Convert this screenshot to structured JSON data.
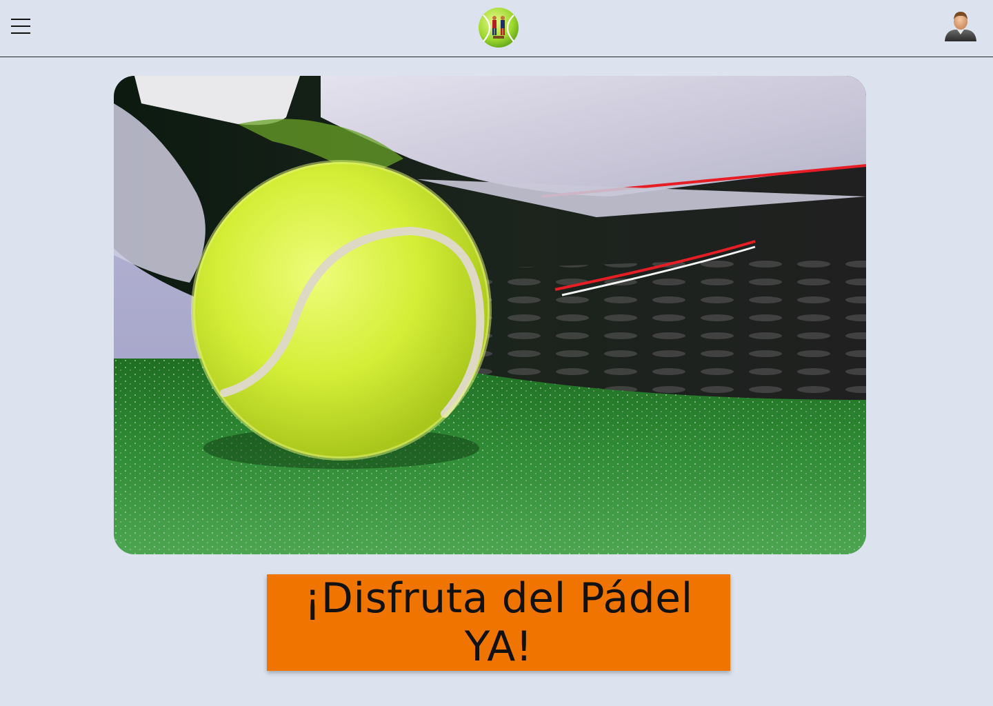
{
  "header": {
    "menu_icon": "hamburger-menu-icon",
    "logo_icon": "tennis-ball-logo",
    "avatar_icon": "user-avatar-icon"
  },
  "hero": {
    "image": "padel-racket-and-ball-photo"
  },
  "cta": {
    "label": "¡Disfruta del Pádel YA!"
  },
  "colors": {
    "background": "#dde3ee",
    "cta_background": "#f07400",
    "ball": "#d9ef3c",
    "turf": "#2f8a35"
  }
}
